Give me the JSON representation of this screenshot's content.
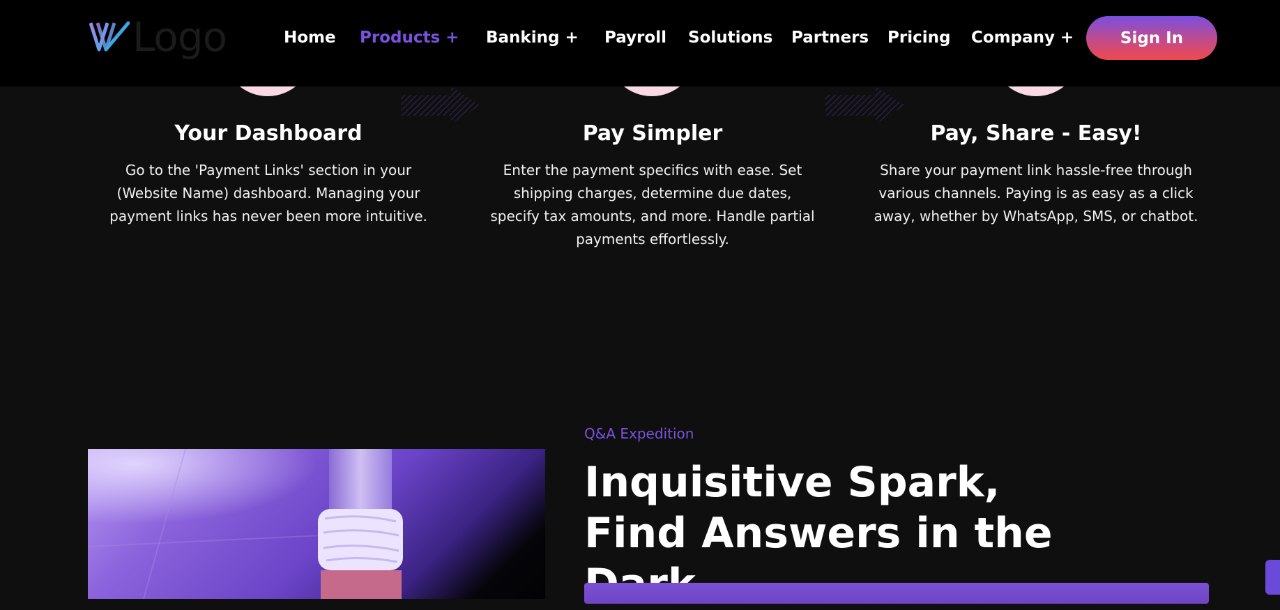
{
  "header": {
    "logo_text": "Logo",
    "nav": [
      {
        "label": "Home"
      },
      {
        "label": "Products +"
      },
      {
        "label": "Banking +"
      },
      {
        "label": "Payroll"
      },
      {
        "label": "Solutions"
      },
      {
        "label": "Partners"
      },
      {
        "label": "Pricing"
      },
      {
        "label": "Company +"
      }
    ],
    "active_nav": "Products +",
    "signin_label": "Sign In"
  },
  "steps": [
    {
      "title": "Your Dashboard",
      "text": "Go to the 'Payment Links' section in your (Website Name) dashboard. Managing your payment links has never been more intuitive."
    },
    {
      "title": "Pay Simpler",
      "text": "Enter the payment specifics with ease. Set shipping charges, determine due dates, specify tax amounts, and more. Handle partial payments effortlessly."
    },
    {
      "title": "Pay, Share - Easy!",
      "text": "Share your payment link hassle-free through various channels. Paying is as easy as a click away, whether by WhatsApp, SMS, or chatbot."
    }
  ],
  "faq": {
    "eyebrow": "Q&A Expedition",
    "heading": "Inquisitive Spark, Find Answers in the Dark"
  },
  "colors": {
    "accent": "#7b52e0",
    "background": "#0f0f0f",
    "header_bg": "#000000",
    "signin_gradient_top": "#7a4fe0",
    "signin_gradient_bottom": "#ef4a4c",
    "step_circle": "#f9d9e3"
  },
  "icons": [
    "logo-mark-icon",
    "arrow-right-icon"
  ]
}
